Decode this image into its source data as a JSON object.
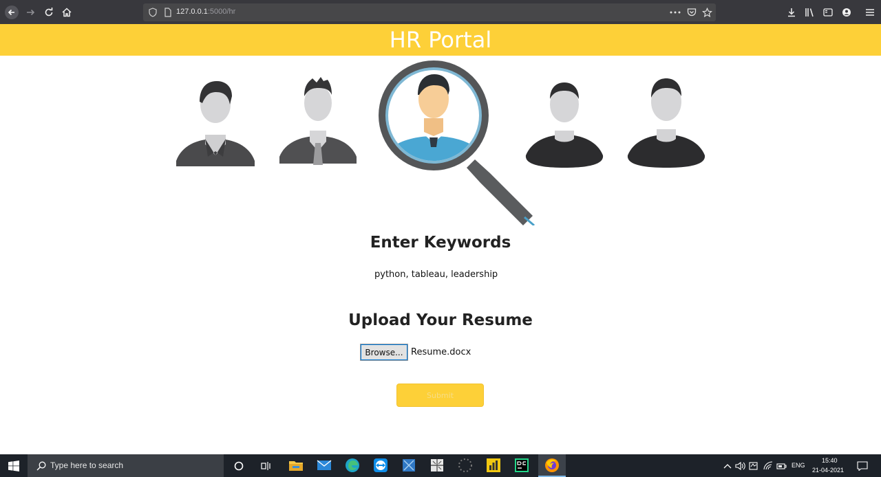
{
  "browser": {
    "url_host": "127.0.0.1",
    "url_rest": ":5000/hr"
  },
  "page": {
    "title": "HR Portal",
    "keywords_heading": "Enter Keywords",
    "keywords_value": "python, tableau, leadership",
    "upload_heading": "Upload Your Resume",
    "browse_label": "Browse...",
    "file_name": "Resume.docx",
    "submit_label": "Submit"
  },
  "taskbar": {
    "search_placeholder": "Type here to search",
    "language": "ENG",
    "time": "15:40",
    "date": "21-04-2021"
  },
  "colors": {
    "accent": "#fdd038",
    "browser_chrome": "#38383d",
    "taskbar": "#1d2229"
  }
}
